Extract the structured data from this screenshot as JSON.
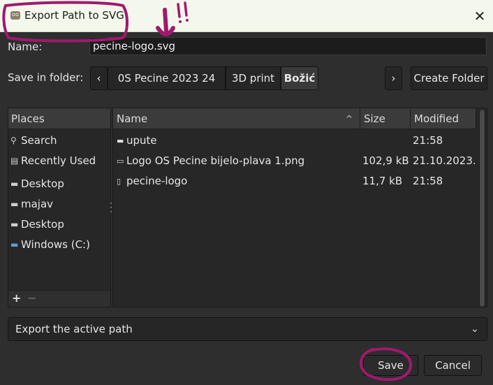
{
  "window": {
    "title": "Export Path to SVG",
    "icon": "gimp-icon",
    "close_glyph": "✕"
  },
  "name_row": {
    "label": "Name:",
    "value": "pecine-logo.svg"
  },
  "folder_row": {
    "label": "Save in folder:",
    "back_glyph": "‹",
    "forward_glyph": "›",
    "path": [
      "0S Pecine 2023 24",
      "3D print",
      "Božić"
    ],
    "create_folder": "Create Folder"
  },
  "places": {
    "header": "Places",
    "items": [
      {
        "label": "Search",
        "icon": "search-icon",
        "glyph": "🔍"
      },
      {
        "label": "Recently Used",
        "icon": "recent-icon",
        "glyph": "▤"
      },
      {
        "label": "Desktop",
        "icon": "folder-icon",
        "glyph": "▬"
      },
      {
        "label": "majav",
        "icon": "folder-icon",
        "glyph": "▬"
      },
      {
        "label": "Desktop",
        "icon": "folder-icon",
        "glyph": "▬"
      },
      {
        "label": "Windows (C:)",
        "icon": "drive-icon",
        "glyph": "▬"
      }
    ],
    "add_glyph": "+",
    "remove_glyph": "−"
  },
  "files": {
    "columns": {
      "name": "Name",
      "size": "Size",
      "modified": "Modified"
    },
    "sort_glyph": "^",
    "rows": [
      {
        "name": "upute",
        "size": "",
        "modified": "21:58",
        "icon": "folder-icon",
        "glyph": "▬"
      },
      {
        "name": "Logo OS Pecine bijelo-plava 1.png",
        "size": "102,9 kB",
        "modified": "21.10.2023.",
        "icon": "image-file-icon",
        "glyph": "▭"
      },
      {
        "name": "pecine-logo",
        "size": "11,7 kB",
        "modified": "21:58",
        "icon": "file-icon",
        "glyph": "▯"
      }
    ]
  },
  "filter": {
    "value": "Export the active path",
    "arrow_glyph": "⌄"
  },
  "buttons": {
    "save": "Save",
    "cancel": "Cancel"
  },
  "colors": {
    "annotation": "#a0196e",
    "background": "#2e2e2e",
    "titlebar": "#f4f8ec"
  }
}
